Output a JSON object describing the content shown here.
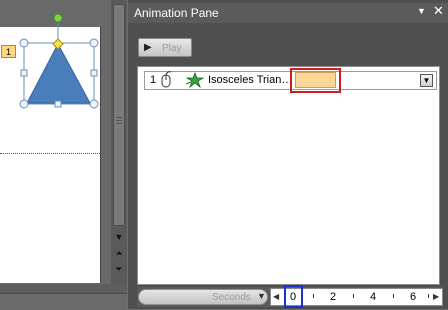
{
  "slide": {
    "animation_tag": "1",
    "shape_color": "#4a7ebb",
    "shape_outline": "#3465a4"
  },
  "pane": {
    "title": "Animation Pane",
    "menu_icon": "chevron-down-icon",
    "close_icon": "close-icon",
    "play_label": "Play",
    "items": [
      {
        "number": "1",
        "trigger_icon": "mouse-icon",
        "effect_icon": "entrance-star-icon",
        "label": "Isosceles Trian…",
        "timing_color": "#fbd694"
      }
    ]
  },
  "timeline": {
    "units_label": "Seconds",
    "ticks": [
      "0",
      "2",
      "4",
      "6"
    ]
  },
  "highlights": {
    "timing_box_color": "#d21b1b",
    "zero_box_color": "#1c2fd1"
  }
}
